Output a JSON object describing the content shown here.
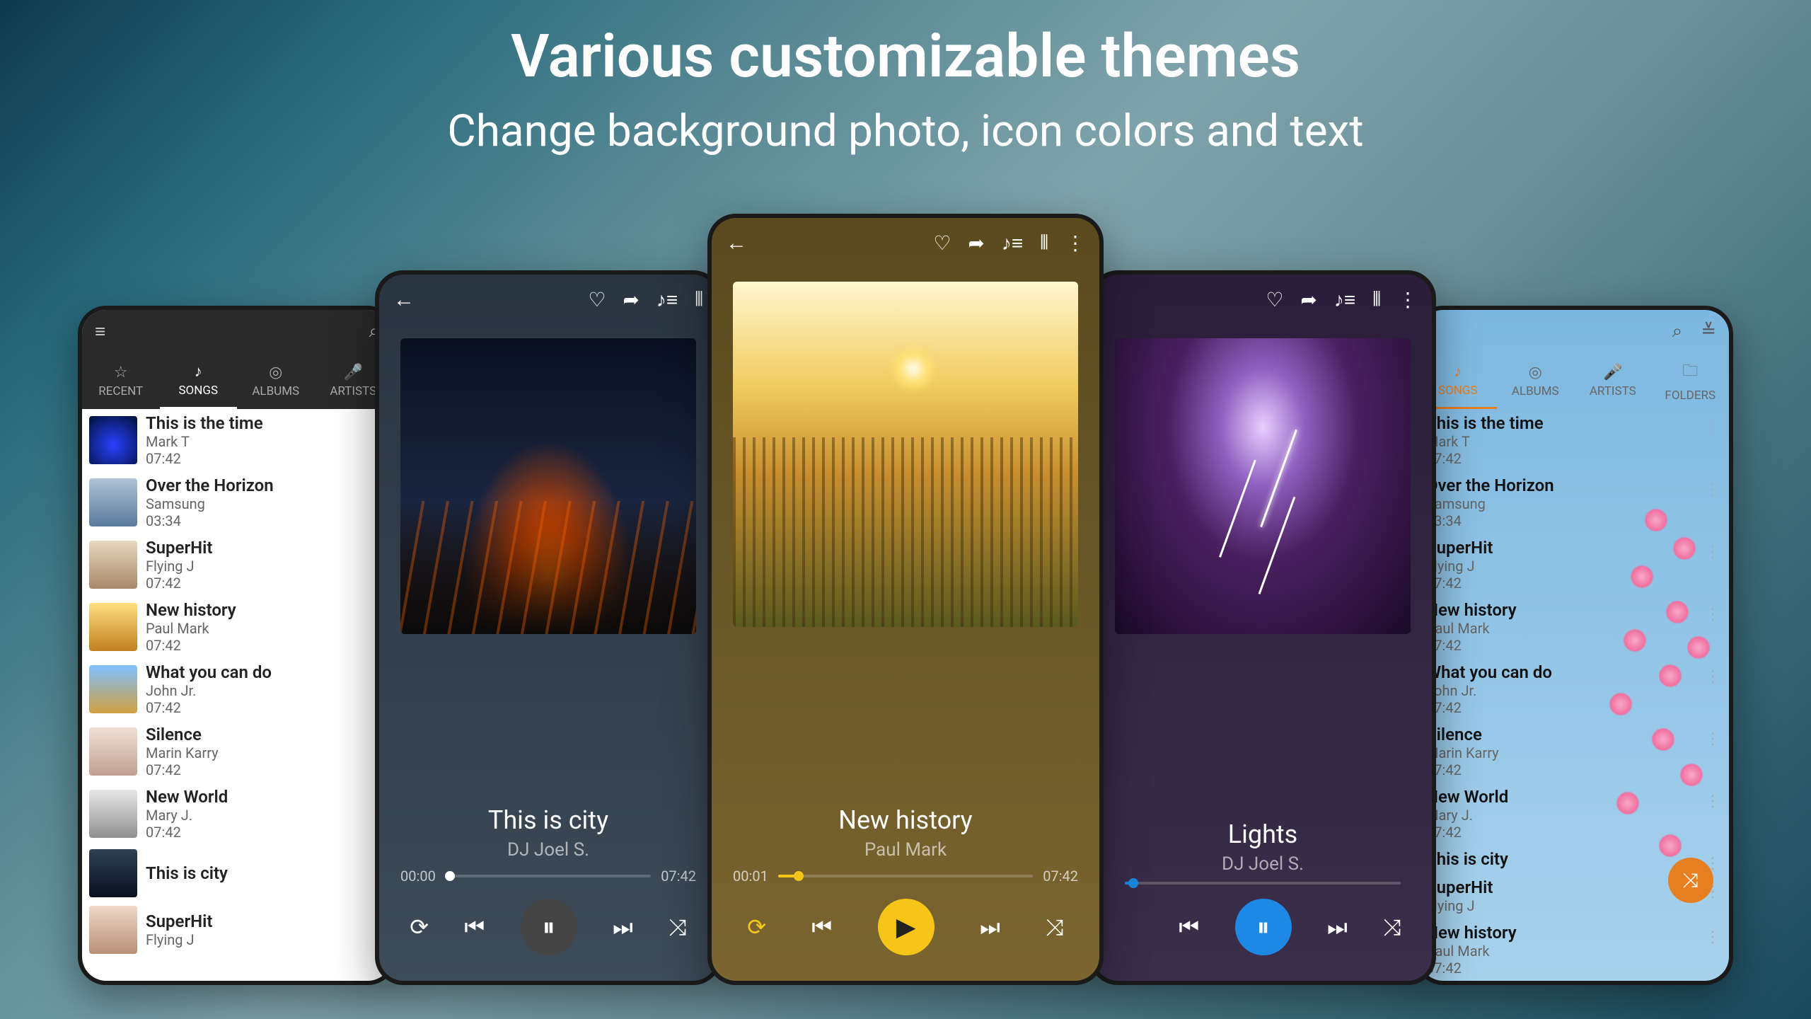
{
  "header": {
    "title": "Various customizable themes",
    "subtitle": "Change background photo, icon colors and text"
  },
  "tabs1": [
    "RECENT",
    "SONGS",
    "ALBUMS",
    "ARTISTS"
  ],
  "tabs5": [
    "SONGS",
    "ALBUMS",
    "ARTISTS",
    "FOLDERS"
  ],
  "active_tab": "SONGS",
  "songs": [
    {
      "title": "This is the time",
      "artist": "Mark T",
      "dur": "07:42"
    },
    {
      "title": "Over the Horizon",
      "artist": "Samsung",
      "dur": "03:34"
    },
    {
      "title": "SuperHit",
      "artist": "Flying J",
      "dur": "07:42"
    },
    {
      "title": "New history",
      "artist": "Paul Mark",
      "dur": "07:42"
    },
    {
      "title": "What you can do",
      "artist": "John Jr.",
      "dur": "07:42"
    },
    {
      "title": "Silence",
      "artist": "Marin Karry",
      "dur": "07:42"
    },
    {
      "title": "New World",
      "artist": "Mary J.",
      "dur": "07:42"
    },
    {
      "title": "This is city",
      "artist": "",
      "dur": ""
    },
    {
      "title": "SuperHit",
      "artist": "Flying J",
      "dur": ""
    }
  ],
  "songs5_extra": {
    "title": "New history",
    "artist": "Paul Mark",
    "dur": "07:42"
  },
  "np2": {
    "title": "This is city",
    "artist": "DJ Joel S.",
    "elapsed": "00:00",
    "total": "07:42",
    "progress": 2
  },
  "np3": {
    "title": "New history",
    "artist": "Paul Mark",
    "elapsed": "00:01",
    "total": "07:42",
    "progress": 8
  },
  "np4": {
    "title": "Lights",
    "artist": "DJ Joel S.",
    "elapsed": "",
    "total": "",
    "progress": 3
  },
  "icons": {
    "back": "←",
    "heart": "♡",
    "share": "➦",
    "queue": "♪≡",
    "eq": "⫴",
    "more": "⋮",
    "repeat": "⟳",
    "prev": "⏮",
    "next": "⏭",
    "pause": "⏸",
    "play": "▶",
    "shuffle": "⤨",
    "menu": "≡",
    "search": "⌕",
    "sort": "≚",
    "star": "☆",
    "note": "♪",
    "disc": "◎",
    "mic": "🎤",
    "folder": "🗀"
  }
}
